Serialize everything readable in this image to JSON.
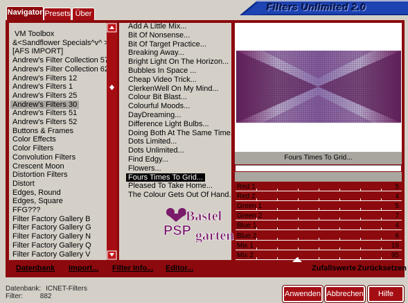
{
  "title": "Filters Unlimited 2.0",
  "tabs": [
    "Navigator",
    "Presets",
    "Über"
  ],
  "categories": [
    "VM Toolbox",
    "&<Sandflower Specials^v^ >",
    "[AFS IMPORT]",
    "Andrew's Filter Collection 57",
    "Andrew's Filter Collection 62",
    "Andrew's Filters 12",
    "Andrew's Filters 1",
    "Andrew's Filters 25",
    "Andrew's Filters 30",
    "Andrew's Filters 51",
    "Andrew's Filters 52",
    "Buttons & Frames",
    "Color Effects",
    "Color Filters",
    "Convolution Filters",
    "Crescent Moon",
    "Distortion Filters",
    "Distort",
    "Edges, Round",
    "Edges, Square",
    "FFG???",
    "Filter Factory Gallery B",
    "Filter Factory Gallery G",
    "Filter Factory Gallery N",
    "Filter Factory Gallery Q",
    "Filter Factory Gallery V"
  ],
  "filters": [
    "Add A Little Mix...",
    "Bit Of Nonsense...",
    "Bit Of Target Practice...",
    "Breaking Away...",
    "Bright Light On The Horizon...",
    "Bubbles In Space ...",
    "Cheap Video Trick...",
    "ClerkenWell On My Mind...",
    "Colour Bit Blast...",
    "Colourful Moods...",
    "DayDreaming...",
    "Difference Light Bulbs...",
    "Doing Both At The Same Time...",
    "Dots Limited...",
    "Dots Unlimited...",
    "Find Edgy...",
    "Flowers...",
    "Fours Times To Grid...",
    "Pleased To Take Home...",
    "The Colour Gets Out Of Hand..."
  ],
  "selected_filter_name": "Fours Times To Grid...",
  "sliders": [
    {
      "label": "Red 1",
      "value": "5"
    },
    {
      "label": "Red 2",
      "value": "4"
    },
    {
      "label": "Green 1",
      "value": "5"
    },
    {
      "label": "Green 2",
      "value": "7"
    },
    {
      "label": "Blue 1",
      "value": "4"
    },
    {
      "label": "Blue 2",
      "value": "6"
    },
    {
      "label": "Mix 1",
      "value": "18"
    },
    {
      "label": "Mix 2",
      "value": "95"
    }
  ],
  "bottom_links": [
    "Datenbank",
    "Import...",
    "Filter Info...",
    "Editor..."
  ],
  "random_label": "Zufallswerte",
  "reset_label": "Zurücksetzen",
  "status": {
    "db_label": "Datenbank:",
    "db_value": "ICNET-Filters",
    "filter_label": "Filter:",
    "filter_value": "882"
  },
  "buttons": {
    "apply": "Anwenden",
    "cancel": "Abbrechen",
    "help": "Hilfe"
  },
  "watermark": "Bastel PSP garten",
  "colors": {
    "accent": "#8c0a0d",
    "title_blue": "#1a3a9a",
    "selection": "#000000"
  }
}
